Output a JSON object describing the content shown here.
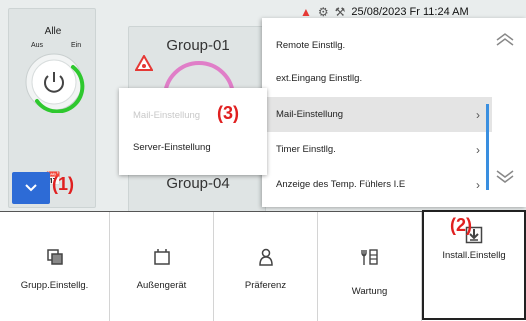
{
  "status": {
    "datetime": "25/08/2023 Fr 11:24 AM"
  },
  "left_panel": {
    "title": "Alle",
    "off_label": "Aus",
    "on_label": "Ein"
  },
  "groups": [
    {
      "label": "Group-01"
    },
    {
      "label": "Group-04"
    }
  ],
  "submenu": {
    "item_disabled": "Mail-Einstellung",
    "item_server": "Server-Einstellung"
  },
  "menu": {
    "items": [
      {
        "label": "Remote Einstllg."
      },
      {
        "label": "ext.Eingang Einstllg."
      },
      {
        "label": "Mail-Einstellung"
      },
      {
        "label": "Timer Einstllg."
      },
      {
        "label": "Anzeige des Temp. Fühlers I.E"
      }
    ],
    "selected_index": 2
  },
  "annotations": {
    "a1": "(1)",
    "a2": "(2)",
    "a3": "(3)"
  },
  "bottom_tabs": [
    {
      "label": "Grupp.Einstellg.",
      "icon": "group-settings-icon"
    },
    {
      "label": "Außengerät",
      "icon": "outdoor-unit-icon"
    },
    {
      "label": "Präferenz",
      "icon": "preference-icon"
    },
    {
      "label": "Wartung",
      "icon": "maintenance-icon"
    },
    {
      "label": "Install.Einstellg",
      "icon": "install-settings-icon"
    }
  ],
  "colors": {
    "accent_blue": "#2d6bd6",
    "warning_red": "#e53935",
    "power_green": "#2ec82e",
    "annotation_red": "#e02020",
    "scroll_blue": "#3a8fe0"
  }
}
